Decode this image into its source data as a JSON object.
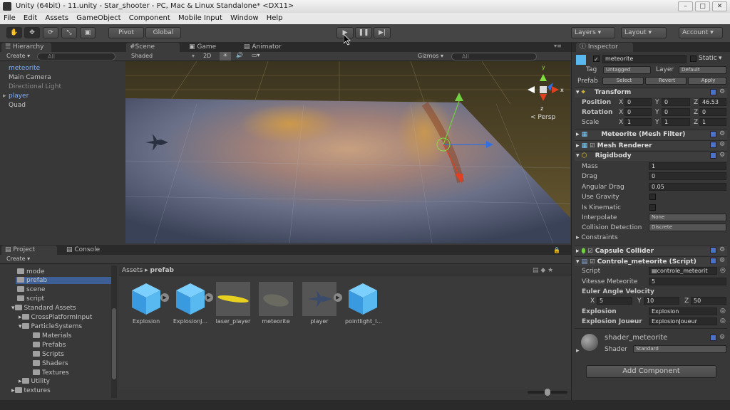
{
  "window": {
    "title": "Unity (64bit) - 11.unity - Star_shooter - PC, Mac & Linux Standalone* <DX11>"
  },
  "menu": [
    "File",
    "Edit",
    "Assets",
    "GameObject",
    "Component",
    "Mobile Input",
    "Window",
    "Help"
  ],
  "toolbar": {
    "pivot": "Pivot",
    "global": "Global",
    "layers": "Layers",
    "layout": "Layout",
    "account": "Account"
  },
  "hierarchy": {
    "tab": "Hierarchy",
    "create": "Create",
    "search_placeholder": "All",
    "items": [
      "meteorite",
      "Main Camera",
      "Directional Light",
      "player",
      "Quad"
    ]
  },
  "scene": {
    "tabs": [
      "Scene",
      "Game",
      "Animator"
    ],
    "shading": "Shaded",
    "mode_2d": "2D",
    "gizmos": "Gizmos",
    "search_placeholder": "All",
    "persp": "Persp",
    "gizmo_axes": [
      "y",
      "x",
      "z"
    ]
  },
  "project": {
    "tabs": [
      "Project",
      "Console"
    ],
    "create": "Create",
    "tree": [
      "mode",
      "prefab",
      "scene",
      "script",
      "Standard Assets",
      "CrossPlatformInput",
      "ParticleSystems",
      "Materials",
      "Prefabs",
      "Scripts",
      "Shaders",
      "Textures",
      "Utility",
      "textures"
    ],
    "breadcrumb": [
      "Assets",
      "prefab"
    ],
    "assets": [
      "Explosion",
      "ExplosionJ...",
      "laser_player",
      "meteorite",
      "player",
      "pointlight_l..."
    ]
  },
  "inspector": {
    "tab": "Inspector",
    "name": "meteorite",
    "static": "Static",
    "tag_label": "Tag",
    "tag": "Untagged",
    "layer_label": "Layer",
    "layer": "Default",
    "prefab_label": "Prefab",
    "select": "Select",
    "revert": "Revert",
    "apply": "Apply",
    "transform": {
      "title": "Transform",
      "position": {
        "label": "Position",
        "x": "0",
        "y": "0",
        "z": "46.53"
      },
      "rotation": {
        "label": "Rotation",
        "x": "0",
        "y": "0",
        "z": "0"
      },
      "scale": {
        "label": "Scale",
        "x": "1",
        "y": "1",
        "z": "1"
      }
    },
    "mesh_filter": "Meteorite (Mesh Filter)",
    "mesh_renderer": "Mesh Renderer",
    "rigidbody": {
      "title": "Rigidbody",
      "mass": {
        "label": "Mass",
        "value": "1"
      },
      "drag": {
        "label": "Drag",
        "value": "0"
      },
      "angular_drag": {
        "label": "Angular Drag",
        "value": "0.05"
      },
      "use_gravity": "Use Gravity",
      "is_kinematic": "Is Kinematic",
      "interpolate": {
        "label": "Interpolate",
        "value": "None"
      },
      "collision": {
        "label": "Collision Detection",
        "value": "Discrete"
      },
      "constraints": "Constraints"
    },
    "capsule": "Capsule Collider",
    "script": {
      "title": "Controle_meteorite (Script)",
      "script_label": "Script",
      "script_value": "controle_meteorit",
      "vitesse_label": "Vitesse Meteorite",
      "vitesse_value": "5",
      "euler_label": "Euler Angle Velocity",
      "ex": "5",
      "ey": "10",
      "ez": "50",
      "explosion_label": "Explosion",
      "explosion_value": "Explosion",
      "explosion_j_label": "Explosion Joueur",
      "explosion_j_value": "ExplosionJoueur"
    },
    "material": {
      "name": "shader_meteorite",
      "shader_label": "Shader",
      "shader_value": "Standard"
    },
    "add_component": "Add Component"
  },
  "axis_letters": {
    "x": "X",
    "y": "Y",
    "z": "Z"
  }
}
